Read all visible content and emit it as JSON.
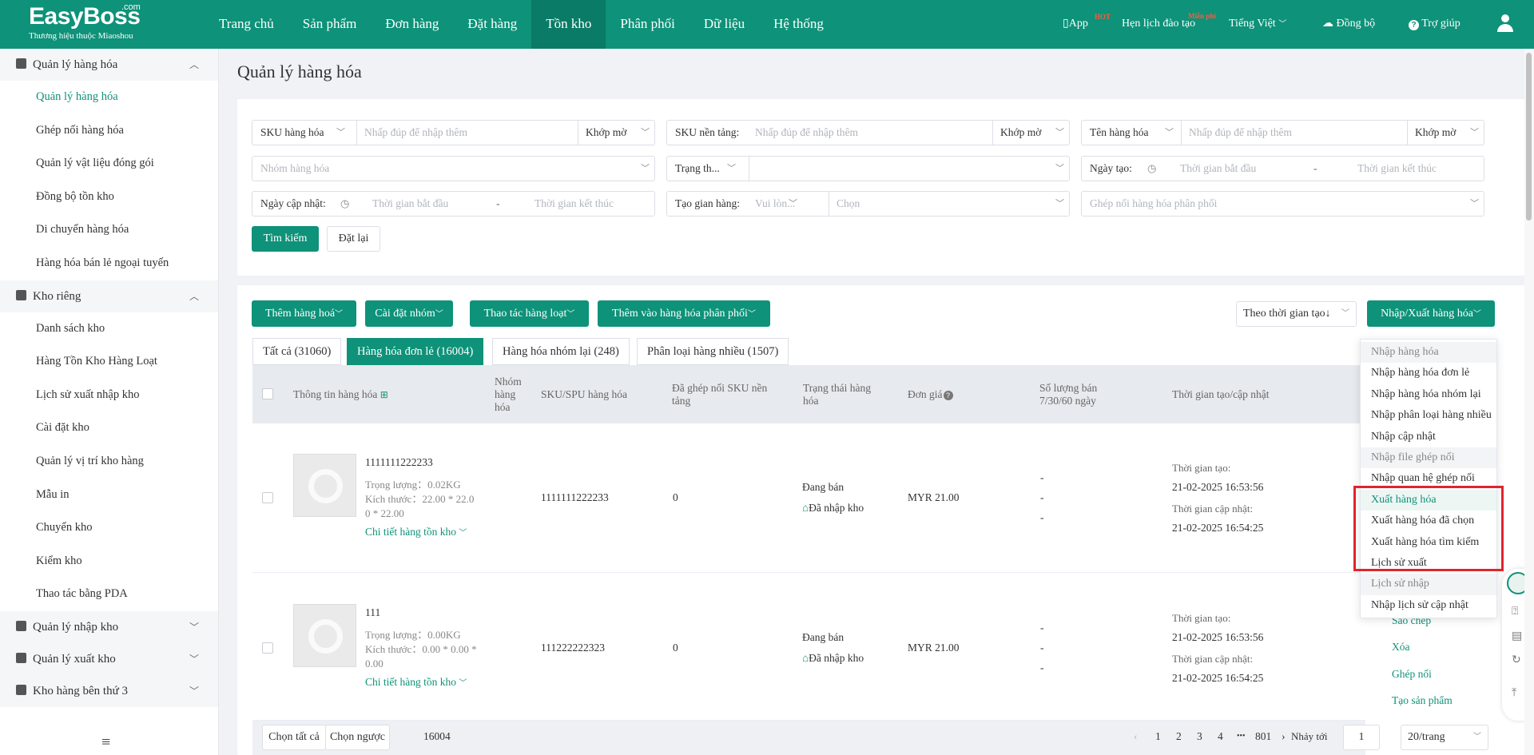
{
  "topbar": {
    "logo": "EasyBoss",
    "logo_com": ".com",
    "logo_sub": "Thương hiệu thuộc Miaoshou",
    "nav": [
      "Trang chủ",
      "Sản phẩm",
      "Đơn hàng",
      "Đặt hàng",
      "Tồn kho",
      "Phân phối",
      "Dữ liệu",
      "Hệ thống"
    ],
    "active_nav": "Tồn kho",
    "app": "App",
    "app_badge": "HOT",
    "training": "Hẹn lịch đào tạo",
    "training_badge": "Miễn phí",
    "language": "Tiếng Việt",
    "sync": "Đồng bộ",
    "help": "Trợ giúp"
  },
  "sidebar": {
    "groups": [
      {
        "label": "Quản lý hàng hóa",
        "items": [
          "Quản lý hàng hóa",
          "Ghép nối hàng hóa",
          "Quản lý vật liệu đóng gói",
          "Đồng bộ tồn kho",
          "Di chuyển hàng hóa",
          "Hàng hóa bán lẻ ngoại tuyến"
        ]
      },
      {
        "label": "Kho riêng",
        "items": [
          "Danh sách kho",
          "Hàng Tồn Kho Hàng Loạt",
          "Lịch sử xuất nhập kho",
          "Cài đặt kho",
          "Quản lý vị trí kho hàng",
          "Mẫu in",
          "Chuyển kho",
          "Kiểm kho",
          "Thao tác bằng PDA"
        ]
      },
      {
        "label": "Quản lý nhập kho",
        "items": []
      },
      {
        "label": "Quản lý xuất kho",
        "items": []
      },
      {
        "label": "Kho hàng bên thứ 3",
        "items": []
      }
    ],
    "active_item": "Quản lý hàng hóa"
  },
  "page": {
    "title": "Quản lý hàng hóa"
  },
  "filters": {
    "sku_label": "SKU hàng hóa",
    "placeholder_dbl": "Nhấp đúp để nhập thêm",
    "match": "Khớp mờ",
    "platform_sku_label": "SKU nền tảng:",
    "name_label": "Tên hàng hóa",
    "group_ph": "Nhóm hàng hóa",
    "status_label": "Trạng th...",
    "created_label": "Ngày tạo:",
    "start_ph": "Thời gian bắt đầu",
    "end_ph": "Thời gian kết thúc",
    "dash": "-",
    "updated_label": "Ngày cập nhật:",
    "created_store_label": "Tạo gian hàng:",
    "select_ph": "Vui lòn...",
    "choose_ph": "Chọn",
    "pair_ph": "Ghép nối hàng hóa phân phối",
    "search_btn": "Tìm kiếm",
    "reset_btn": "Đặt lại"
  },
  "toolbar": {
    "add": "Thêm hàng hoá",
    "group_settings": "Cài đặt nhóm",
    "batch": "Thao tác hàng loạt",
    "add_dist": "Thêm vào hàng hóa phân phối",
    "sort": "Theo thời gian tạo↓",
    "import_export": "Nhập/Xuất hàng hóa"
  },
  "tabs": [
    "Tất cả (31060)",
    "Hàng hóa đơn lẻ (16004)",
    "Hàng hóa nhóm lại (248)",
    "Phân loại hàng nhiều (1507)"
  ],
  "active_tab": "Hàng hóa đơn lẻ (16004)",
  "table": {
    "headers": {
      "info": "Thông tin hàng hóa",
      "group_l1": "Nhóm",
      "group_l2": "hàng",
      "group_l3": "hóa",
      "sku": "SKU/SPU hàng hóa",
      "paired_l1": "Đã ghép nối SKU nền",
      "paired_l2": "tảng",
      "status_l1": "Trạng thái hàng",
      "status_l2": "hóa",
      "price": "Đơn giá",
      "sold_l1": "Số lượng bán",
      "sold_l2": "7/30/60 ngày",
      "time": "Thời gian tạo/cập nhật"
    },
    "rows": [
      {
        "name": "1111111222233",
        "weight": "Trọng lượng：0.02KG",
        "size_l1": "Kích thước：22.00 * 22.0",
        "size_l2": "0 * 22.00",
        "detail": "Chi tiết hàng tồn kho",
        "sku": "1111111222233",
        "paired": "0",
        "status": "Đang bán",
        "warehouse": "Đã nhập kho",
        "price": "MYR 21.00",
        "sold": [
          "-",
          "-",
          "-"
        ],
        "created_label": "Thời gian tạo:",
        "created": "21-02-2025 16:53:56",
        "updated_label": "Thời gian cập nhật:",
        "updated": "21-02-2025 16:54:25"
      },
      {
        "name": "111",
        "weight": "Trọng lượng：0.00KG",
        "size_l1": "Kích thước：0.00 * 0.00 *",
        "size_l2": "0.00",
        "detail": "Chi tiết hàng tồn kho",
        "sku": "111222222323",
        "paired": "0",
        "status": "Đang bán",
        "warehouse": "Đã nhập kho",
        "price": "MYR 21.00",
        "sold": [
          "-",
          "-",
          "-"
        ],
        "created_label": "Thời gian tạo:",
        "created": "21-02-2025 16:53:56",
        "updated_label": "Thời gian cập nhật:",
        "updated": "21-02-2025 16:54:25",
        "actions": [
          "Sao chép",
          "Xóa",
          "Ghép nối",
          "Tạo sản phẩm"
        ]
      }
    ]
  },
  "dropdown": {
    "items": [
      {
        "label": "Nhập hàng hóa",
        "header": true
      },
      {
        "label": "Nhập hàng hóa đơn lẻ"
      },
      {
        "label": "Nhập hàng hóa nhóm lại"
      },
      {
        "label": "Nhập phân loại hàng nhiều"
      },
      {
        "label": "Nhập cập nhật"
      },
      {
        "label": "Nhập file ghép nối",
        "header": true
      },
      {
        "label": "Nhập quan hệ ghép nối"
      },
      {
        "label": "Xuất hàng hóa",
        "highlight": true
      },
      {
        "label": "Xuất hàng hóa đã chọn"
      },
      {
        "label": "Xuất hàng hóa tìm kiếm"
      },
      {
        "label": "Lịch sử xuất"
      },
      {
        "label": "Lịch sử nhập",
        "header": true
      },
      {
        "label": "Nhập lịch sử cập nhật"
      }
    ]
  },
  "pager": {
    "select_all": "Chọn tất cả",
    "invert": "Chọn ngược",
    "count": "16004",
    "pages": [
      "1",
      "2",
      "3",
      "4"
    ],
    "current_page": "1",
    "ellipsis": "•••",
    "last": "801",
    "jump_label": "Nhảy tới",
    "jump_value": "1",
    "page_size": "20/trang"
  },
  "colors": {
    "brand": "#0e9279",
    "highlight_border": "#e0242e"
  }
}
